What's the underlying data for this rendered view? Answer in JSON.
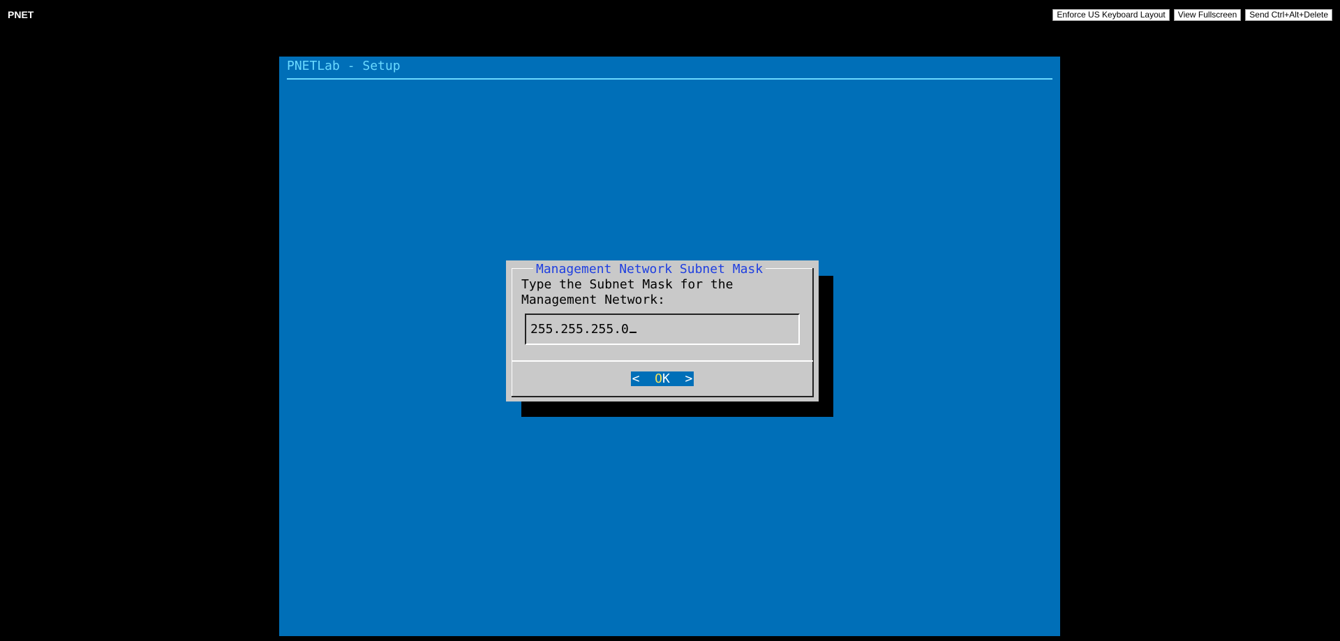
{
  "header": {
    "brand": "PNET",
    "buttons": [
      "Enforce US Keyboard Layout",
      "View Fullscreen",
      "Send Ctrl+Alt+Delete"
    ]
  },
  "console": {
    "title": "PNETLab - Setup",
    "background_color": "#006fb8",
    "dialog": {
      "title": "Management Network Subnet Mask",
      "prompt_line1": "Type the Subnet Mask for the",
      "prompt_line2": "Management Network:",
      "input_value": "255.255.255.0",
      "ok_label_left": "<  ",
      "ok_label_key": "O",
      "ok_label_rest": "K",
      "ok_label_right": "  >"
    }
  }
}
